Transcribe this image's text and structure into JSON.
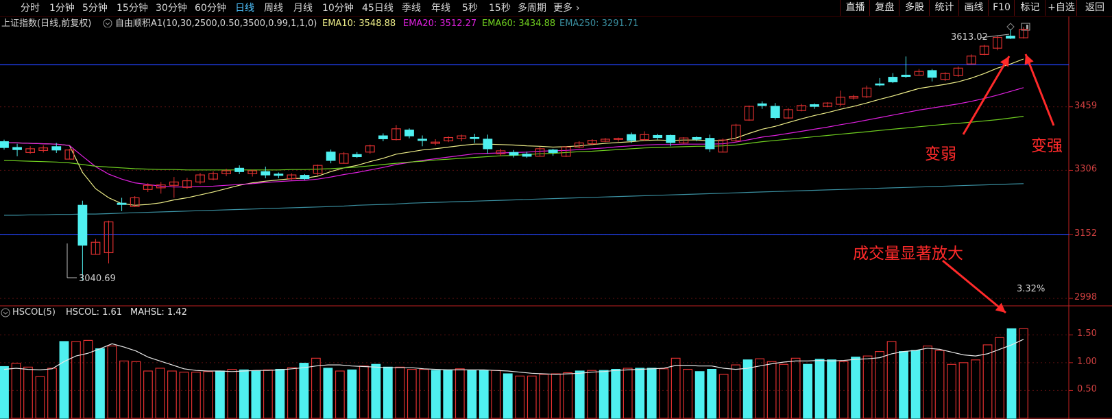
{
  "toolbar": {
    "periods": [
      "分时",
      "1分钟",
      "5分钟",
      "15分钟",
      "30分钟",
      "60分钟",
      "日线",
      "周线",
      "月线",
      "10分钟",
      "45日线",
      "季线",
      "年线",
      "5秒",
      "15秒",
      "多周期",
      "更多"
    ],
    "active_period": "日线",
    "more_arrow": "›",
    "right_buttons": [
      "直播",
      "复盘",
      "多股",
      "统计",
      "画线",
      "F10",
      "标记",
      "+自选",
      "返回"
    ]
  },
  "indicators": {
    "title": "上证指数(日线,前复权)",
    "dropdown_icon": "circle-chevron-icon",
    "formula": "自由顺积A1(10,30,2500,0.50,3500,0.99,1,1,0)",
    "ema10": "EMA10: 3548.88",
    "ema20": "EMA20: 3512.27",
    "ema60": "EMA60: 3434.88",
    "ema250": "EMA250: 3291.71"
  },
  "colors": {
    "ema10": "#f0f08a",
    "ema20": "#e020e0",
    "ema60": "#70d020",
    "ema250": "#3a8fa0",
    "up": "#e03030",
    "down": "#4ff0f0",
    "hline": "#2244ff",
    "axis": "#c02020",
    "annotation": "#ff2a2a"
  },
  "price_axis": [
    "3459",
    "3306",
    "3152",
    "2998"
  ],
  "volume_axis": [
    "1.50",
    "1.00",
    "0.50"
  ],
  "volume_panel": {
    "label_icon": "circle-chevron-icon",
    "title": "HSCOL(5)",
    "hscol": "HSCOL: 1.61",
    "mahsl": "MAHSL: 1.42"
  },
  "annotations": {
    "high_price": "3613.02",
    "low_price": "3040.69",
    "weaker": "变弱",
    "stronger": "变强",
    "volume_note": "成交量显著放大",
    "percent": "3.32%"
  },
  "chart_data": {
    "type": "candlestick",
    "title": "上证指数(日线,前复权)",
    "ylim": [
      2980,
      3640
    ],
    "price_grid": [
      3459,
      3306,
      3152,
      2998
    ],
    "horizontal_levels": [
      3560,
      3152
    ],
    "candles": [
      {
        "o": 3375,
        "c": 3361,
        "h": 3380,
        "l": 3356,
        "up": false
      },
      {
        "o": 3361,
        "c": 3356,
        "h": 3370,
        "l": 3340,
        "up": false
      },
      {
        "o": 3349,
        "c": 3358,
        "h": 3364,
        "l": 3346,
        "up": true
      },
      {
        "o": 3354,
        "c": 3360,
        "h": 3366,
        "l": 3349,
        "up": true
      },
      {
        "o": 3363,
        "c": 3355,
        "h": 3372,
        "l": 3348,
        "up": false
      },
      {
        "o": 3355,
        "c": 3333,
        "h": 3358,
        "l": 3333,
        "up": true
      },
      {
        "o": 3222,
        "c": 3126,
        "h": 3233,
        "l": 3041,
        "up": false
      },
      {
        "o": 3104,
        "c": 3133,
        "h": 3141,
        "l": 3103,
        "up": true
      },
      {
        "o": 3108,
        "c": 3182,
        "h": 3185,
        "l": 3082,
        "up": true
      },
      {
        "o": 3227,
        "c": 3224,
        "h": 3240,
        "l": 3208,
        "up": false
      },
      {
        "o": 3219,
        "c": 3240,
        "h": 3244,
        "l": 3218,
        "up": true
      },
      {
        "o": 3260,
        "c": 3270,
        "h": 3275,
        "l": 3254,
        "up": true
      },
      {
        "o": 3264,
        "c": 3271,
        "h": 3278,
        "l": 3250,
        "up": true
      },
      {
        "o": 3270,
        "c": 3278,
        "h": 3290,
        "l": 3240,
        "up": true
      },
      {
        "o": 3265,
        "c": 3281,
        "h": 3288,
        "l": 3261,
        "up": true
      },
      {
        "o": 3278,
        "c": 3295,
        "h": 3300,
        "l": 3273,
        "up": true
      },
      {
        "o": 3285,
        "c": 3298,
        "h": 3304,
        "l": 3282,
        "up": true
      },
      {
        "o": 3298,
        "c": 3305,
        "h": 3310,
        "l": 3292,
        "up": true
      },
      {
        "o": 3311,
        "c": 3303,
        "h": 3318,
        "l": 3297,
        "up": false
      },
      {
        "o": 3298,
        "c": 3305,
        "h": 3308,
        "l": 3291,
        "up": true
      },
      {
        "o": 3303,
        "c": 3295,
        "h": 3315,
        "l": 3287,
        "up": false
      },
      {
        "o": 3297,
        "c": 3294,
        "h": 3301,
        "l": 3287,
        "up": false
      },
      {
        "o": 3286,
        "c": 3295,
        "h": 3299,
        "l": 3283,
        "up": true
      },
      {
        "o": 3294,
        "c": 3286,
        "h": 3297,
        "l": 3283,
        "up": false
      },
      {
        "o": 3299,
        "c": 3318,
        "h": 3320,
        "l": 3294,
        "up": true
      },
      {
        "o": 3350,
        "c": 3330,
        "h": 3356,
        "l": 3323,
        "up": false
      },
      {
        "o": 3323,
        "c": 3346,
        "h": 3350,
        "l": 3322,
        "up": true
      },
      {
        "o": 3344,
        "c": 3339,
        "h": 3350,
        "l": 3336,
        "up": false
      },
      {
        "o": 3350,
        "c": 3365,
        "h": 3368,
        "l": 3346,
        "up": true
      },
      {
        "o": 3389,
        "c": 3382,
        "h": 3395,
        "l": 3376,
        "up": false
      },
      {
        "o": 3380,
        "c": 3406,
        "h": 3415,
        "l": 3378,
        "up": true
      },
      {
        "o": 3403,
        "c": 3389,
        "h": 3407,
        "l": 3383,
        "up": false
      },
      {
        "o": 3381,
        "c": 3378,
        "h": 3390,
        "l": 3364,
        "up": false
      },
      {
        "o": 3371,
        "c": 3374,
        "h": 3381,
        "l": 3366,
        "up": true
      },
      {
        "o": 3377,
        "c": 3385,
        "h": 3388,
        "l": 3374,
        "up": true
      },
      {
        "o": 3383,
        "c": 3389,
        "h": 3392,
        "l": 3376,
        "up": true
      },
      {
        "o": 3385,
        "c": 3384,
        "h": 3394,
        "l": 3372,
        "up": false
      },
      {
        "o": 3381,
        "c": 3358,
        "h": 3392,
        "l": 3346,
        "up": false
      },
      {
        "o": 3346,
        "c": 3353,
        "h": 3358,
        "l": 3340,
        "up": true
      },
      {
        "o": 3349,
        "c": 3343,
        "h": 3355,
        "l": 3337,
        "up": false
      },
      {
        "o": 3345,
        "c": 3340,
        "h": 3351,
        "l": 3336,
        "up": false
      },
      {
        "o": 3340,
        "c": 3358,
        "h": 3363,
        "l": 3339,
        "up": true
      },
      {
        "o": 3355,
        "c": 3349,
        "h": 3358,
        "l": 3341,
        "up": false
      },
      {
        "o": 3340,
        "c": 3362,
        "h": 3364,
        "l": 3338,
        "up": true
      },
      {
        "o": 3362,
        "c": 3372,
        "h": 3376,
        "l": 3359,
        "up": true
      },
      {
        "o": 3370,
        "c": 3378,
        "h": 3381,
        "l": 3366,
        "up": true
      },
      {
        "o": 3376,
        "c": 3381,
        "h": 3384,
        "l": 3374,
        "up": true
      },
      {
        "o": 3381,
        "c": 3383,
        "h": 3385,
        "l": 3375,
        "up": true
      },
      {
        "o": 3392,
        "c": 3378,
        "h": 3397,
        "l": 3372,
        "up": false
      },
      {
        "o": 3380,
        "c": 3392,
        "h": 3400,
        "l": 3376,
        "up": true
      },
      {
        "o": 3390,
        "c": 3385,
        "h": 3394,
        "l": 3380,
        "up": false
      },
      {
        "o": 3390,
        "c": 3373,
        "h": 3392,
        "l": 3364,
        "up": false
      },
      {
        "o": 3372,
        "c": 3384,
        "h": 3386,
        "l": 3370,
        "up": true
      },
      {
        "o": 3385,
        "c": 3381,
        "h": 3388,
        "l": 3376,
        "up": false
      },
      {
        "o": 3383,
        "c": 3358,
        "h": 3392,
        "l": 3350,
        "up": false
      },
      {
        "o": 3350,
        "c": 3379,
        "h": 3383,
        "l": 3349,
        "up": true
      },
      {
        "o": 3377,
        "c": 3415,
        "h": 3418,
        "l": 3375,
        "up": true
      },
      {
        "o": 3427,
        "c": 3460,
        "h": 3462,
        "l": 3425,
        "up": true
      },
      {
        "o": 3466,
        "c": 3462,
        "h": 3472,
        "l": 3454,
        "up": false
      },
      {
        "o": 3460,
        "c": 3433,
        "h": 3468,
        "l": 3428,
        "up": false
      },
      {
        "o": 3432,
        "c": 3452,
        "h": 3456,
        "l": 3430,
        "up": true
      },
      {
        "o": 3450,
        "c": 3462,
        "h": 3466,
        "l": 3448,
        "up": true
      },
      {
        "o": 3464,
        "c": 3460,
        "h": 3467,
        "l": 3454,
        "up": false
      },
      {
        "o": 3460,
        "c": 3468,
        "h": 3470,
        "l": 3458,
        "up": true
      },
      {
        "o": 3465,
        "c": 3482,
        "h": 3498,
        "l": 3460,
        "up": true
      },
      {
        "o": 3480,
        "c": 3484,
        "h": 3488,
        "l": 3476,
        "up": true
      },
      {
        "o": 3483,
        "c": 3504,
        "h": 3510,
        "l": 3480,
        "up": true
      },
      {
        "o": 3514,
        "c": 3512,
        "h": 3528,
        "l": 3508,
        "up": false
      },
      {
        "o": 3530,
        "c": 3519,
        "h": 3540,
        "l": 3516,
        "up": false
      },
      {
        "o": 3535,
        "c": 3532,
        "h": 3580,
        "l": 3528,
        "up": false
      },
      {
        "o": 3535,
        "c": 3544,
        "h": 3550,
        "l": 3534,
        "up": true
      },
      {
        "o": 3546,
        "c": 3530,
        "h": 3550,
        "l": 3520,
        "up": false
      },
      {
        "o": 3525,
        "c": 3539,
        "h": 3542,
        "l": 3521,
        "up": true
      },
      {
        "o": 3534,
        "c": 3552,
        "h": 3556,
        "l": 3531,
        "up": true
      },
      {
        "o": 3562,
        "c": 3581,
        "h": 3585,
        "l": 3560,
        "up": true
      },
      {
        "o": 3585,
        "c": 3605,
        "h": 3608,
        "l": 3583,
        "up": true
      },
      {
        "o": 3600,
        "c": 3626,
        "h": 3630,
        "l": 3595,
        "up": true
      },
      {
        "o": 3629,
        "c": 3624,
        "h": 3645,
        "l": 3622,
        "up": false
      },
      {
        "o": 3625,
        "c": 3645,
        "h": 3651,
        "l": 3623,
        "up": true
      }
    ],
    "ema_lines": [
      {
        "name": "EMA10",
        "color": "#f0f08a",
        "values": [
          3373,
          3372,
          3371,
          3370,
          3369,
          3366,
          3301,
          3262,
          3240,
          3226,
          3222,
          3224,
          3228,
          3235,
          3240,
          3247,
          3254,
          3262,
          3270,
          3276,
          3280,
          3283,
          3286,
          3287,
          3292,
          3303,
          3312,
          3318,
          3327,
          3335,
          3345,
          3350,
          3355,
          3358,
          3362,
          3366,
          3369,
          3369,
          3368,
          3367,
          3365,
          3364,
          3362,
          3363,
          3365,
          3368,
          3371,
          3373,
          3375,
          3378,
          3379,
          3378,
          3379,
          3379,
          3377,
          3378,
          3384,
          3395,
          3405,
          3412,
          3421,
          3430,
          3438,
          3445,
          3453,
          3460,
          3468,
          3477,
          3485,
          3494,
          3503,
          3508,
          3513,
          3519,
          3528,
          3539,
          3552,
          3562,
          3574
        ]
      },
      {
        "name": "EMA20",
        "color": "#e020e0",
        "values": [
          3373,
          3372,
          3371,
          3370,
          3369,
          3366,
          3340,
          3315,
          3297,
          3285,
          3276,
          3272,
          3268,
          3266,
          3266,
          3267,
          3268,
          3270,
          3272,
          3274,
          3277,
          3279,
          3281,
          3282,
          3285,
          3290,
          3296,
          3301,
          3307,
          3313,
          3320,
          3325,
          3330,
          3334,
          3338,
          3342,
          3346,
          3347,
          3348,
          3349,
          3350,
          3352,
          3353,
          3354,
          3356,
          3358,
          3360,
          3363,
          3365,
          3367,
          3368,
          3368,
          3369,
          3369,
          3369,
          3370,
          3374,
          3380,
          3386,
          3390,
          3395,
          3400,
          3405,
          3410,
          3416,
          3421,
          3427,
          3433,
          3439,
          3445,
          3451,
          3456,
          3461,
          3466,
          3472,
          3479,
          3487,
          3496,
          3505
        ]
      },
      {
        "name": "EMA60",
        "color": "#70d020",
        "values": [
          3330,
          3329,
          3328,
          3327,
          3326,
          3324,
          3320,
          3316,
          3314,
          3312,
          3310,
          3309,
          3308,
          3308,
          3307,
          3307,
          3307,
          3307,
          3307,
          3307,
          3307,
          3307,
          3308,
          3308,
          3309,
          3310,
          3312,
          3314,
          3317,
          3320,
          3323,
          3326,
          3328,
          3331,
          3333,
          3335,
          3337,
          3339,
          3341,
          3342,
          3344,
          3346,
          3347,
          3349,
          3351,
          3352,
          3354,
          3356,
          3358,
          3360,
          3361,
          3362,
          3363,
          3364,
          3364,
          3365,
          3367,
          3371,
          3375,
          3378,
          3381,
          3384,
          3387,
          3390,
          3393,
          3396,
          3399,
          3402,
          3405,
          3408,
          3411,
          3414,
          3417,
          3419,
          3422,
          3425,
          3428,
          3432,
          3436
        ]
      },
      {
        "name": "EMA250",
        "color": "#3a8fa0",
        "values": [
          3198,
          3198,
          3199,
          3199,
          3200,
          3200,
          3201,
          3201,
          3202,
          3203,
          3204,
          3205,
          3206,
          3207,
          3208,
          3209,
          3210,
          3211,
          3212,
          3213,
          3214,
          3215,
          3216,
          3217,
          3218,
          3219,
          3220,
          3222,
          3223,
          3224,
          3225,
          3227,
          3228,
          3229,
          3230,
          3231,
          3232,
          3233,
          3234,
          3235,
          3236,
          3237,
          3238,
          3239,
          3240,
          3241,
          3242,
          3243,
          3244,
          3245,
          3246,
          3247,
          3248,
          3249,
          3250,
          3251,
          3252,
          3253,
          3254,
          3255,
          3256,
          3257,
          3258,
          3259,
          3260,
          3261,
          3262,
          3263,
          3264,
          3265,
          3266,
          3267,
          3268,
          3269,
          3270,
          3271,
          3272,
          3273,
          3274
        ]
      }
    ],
    "volume": {
      "title": "HSCOL(5)",
      "ylim": [
        0,
        1.75
      ],
      "values": [
        0.93,
        0.99,
        0.92,
        0.75,
        0.9,
        1.38,
        1.38,
        1.4,
        1.25,
        1.3,
        1.03,
        1.02,
        0.85,
        0.9,
        0.85,
        0.83,
        0.83,
        0.84,
        0.85,
        0.88,
        0.87,
        0.85,
        0.87,
        0.88,
        0.91,
        0.99,
        1.08,
        0.9,
        0.85,
        0.87,
        0.94,
        0.97,
        0.92,
        0.92,
        0.88,
        0.88,
        0.86,
        0.87,
        0.89,
        0.86,
        0.86,
        0.86,
        0.8,
        0.76,
        0.76,
        0.79,
        0.8,
        0.82,
        0.85,
        0.86,
        0.86,
        0.88,
        0.9,
        0.9,
        0.9,
        0.89,
        1.08,
        0.88,
        0.84,
        0.88,
        0.79,
        0.96,
        1.05,
        1.07,
        1.02,
        0.97,
        1.08,
        0.97,
        1.06,
        1.05,
        1.02,
        1.1,
        1.12,
        1.2,
        1.38,
        1.2,
        1.22,
        1.3,
        1.22,
        0.97,
        1.0,
        1.05,
        1.32,
        1.45,
        1.61,
        1.61
      ],
      "ma": [
        0.88,
        0.9,
        0.88,
        0.87,
        0.89,
        1.02,
        1.12,
        1.17,
        1.25,
        1.34,
        1.28,
        1.21,
        1.1,
        1.03,
        0.96,
        0.89,
        0.86,
        0.85,
        0.85,
        0.84,
        0.85,
        0.86,
        0.86,
        0.87,
        0.89,
        0.91,
        0.94,
        0.96,
        0.96,
        0.94,
        0.93,
        0.92,
        0.91,
        0.91,
        0.91,
        0.89,
        0.88,
        0.87,
        0.87,
        0.87,
        0.87,
        0.86,
        0.85,
        0.83,
        0.81,
        0.8,
        0.79,
        0.8,
        0.81,
        0.83,
        0.84,
        0.86,
        0.87,
        0.88,
        0.89,
        0.9,
        0.95,
        0.95,
        0.94,
        0.94,
        0.9,
        0.88,
        0.9,
        0.94,
        0.98,
        1.01,
        1.03,
        1.03,
        1.04,
        1.03,
        1.04,
        1.06,
        1.07,
        1.09,
        1.16,
        1.2,
        1.22,
        1.26,
        1.24,
        1.19,
        1.14,
        1.12,
        1.16,
        1.24,
        1.32,
        1.42
      ],
      "up": [
        false,
        true,
        true,
        true,
        true,
        false,
        true,
        true,
        false,
        true,
        true,
        true,
        true,
        true,
        true,
        true,
        true,
        true,
        false,
        true,
        false,
        false,
        true,
        false,
        true,
        false,
        true,
        false,
        true,
        false,
        true,
        false,
        false,
        true,
        true,
        true,
        false,
        false,
        true,
        false,
        false,
        true,
        false,
        true,
        true,
        true,
        true,
        true,
        false,
        true,
        false,
        false,
        true,
        false,
        false,
        true,
        true,
        true,
        false,
        false,
        true,
        true,
        false,
        true,
        true,
        true,
        true,
        false,
        false,
        false,
        true,
        false,
        true,
        true,
        true,
        false,
        false,
        true,
        true,
        true,
        true,
        true,
        true,
        true,
        false,
        true
      ]
    }
  }
}
